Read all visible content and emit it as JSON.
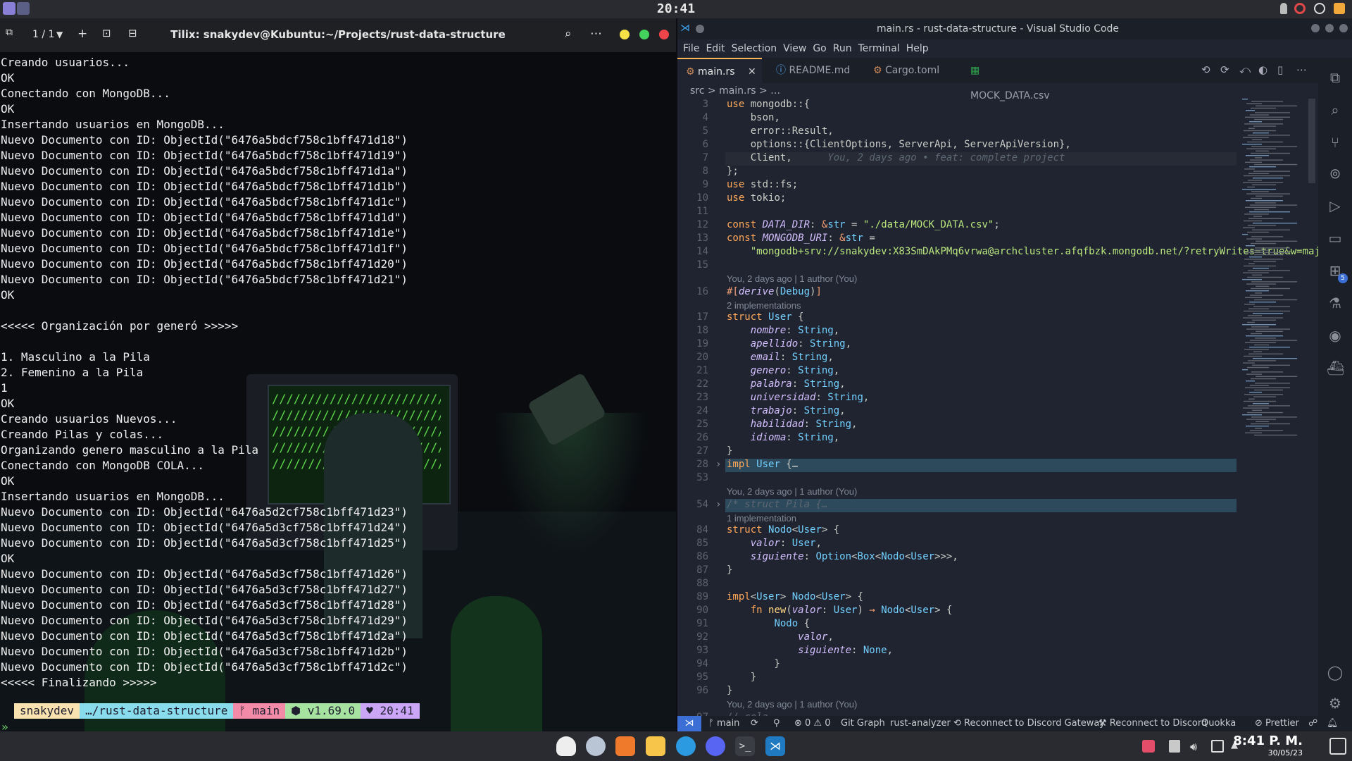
{
  "topbar": {
    "clock": "20:41"
  },
  "terminal": {
    "session": "1 / 1",
    "title": "Tilix: snakydev@Kubuntu:~/Projects/rust-data-structure",
    "lines": [
      "Creando usuarios...",
      "OK",
      "Conectando con MongoDB...",
      "OK",
      "Insertando usuarios en MongoDB...",
      "Nuevo Documento con ID: ObjectId(\"6476a5bdcf758c1bff471d18\")",
      "Nuevo Documento con ID: ObjectId(\"6476a5bdcf758c1bff471d19\")",
      "Nuevo Documento con ID: ObjectId(\"6476a5bdcf758c1bff471d1a\")",
      "Nuevo Documento con ID: ObjectId(\"6476a5bdcf758c1bff471d1b\")",
      "Nuevo Documento con ID: ObjectId(\"6476a5bdcf758c1bff471d1c\")",
      "Nuevo Documento con ID: ObjectId(\"6476a5bdcf758c1bff471d1d\")",
      "Nuevo Documento con ID: ObjectId(\"6476a5bdcf758c1bff471d1e\")",
      "Nuevo Documento con ID: ObjectId(\"6476a5bdcf758c1bff471d1f\")",
      "Nuevo Documento con ID: ObjectId(\"6476a5bdcf758c1bff471d20\")",
      "Nuevo Documento con ID: ObjectId(\"6476a5bdcf758c1bff471d21\")",
      "OK",
      "",
      "<<<<< Organización por generó >>>>>",
      "",
      "1. Masculino a la Pila",
      "2. Femenino a la Pila",
      "1",
      "OK",
      "Creando usuarios Nuevos...",
      "Creando Pilas y colas...",
      "Organizando genero masculino a la Pila",
      "Conectando con MongoDB COLA...",
      "OK",
      "Insertando usuarios en MongoDB...",
      "Nuevo Documento con ID: ObjectId(\"6476a5d2cf758c1bff471d23\")",
      "Nuevo Documento con ID: ObjectId(\"6476a5d3cf758c1bff471d24\")",
      "Nuevo Documento con ID: ObjectId(\"6476a5d3cf758c1bff471d25\")",
      "OK",
      "Nuevo Documento con ID: ObjectId(\"6476a5d3cf758c1bff471d26\")",
      "Nuevo Documento con ID: ObjectId(\"6476a5d3cf758c1bff471d27\")",
      "Nuevo Documento con ID: ObjectId(\"6476a5d3cf758c1bff471d28\")",
      "Nuevo Documento con ID: ObjectId(\"6476a5d3cf758c1bff471d29\")",
      "Nuevo Documento con ID: ObjectId(\"6476a5d3cf758c1bff471d2a\")",
      "Nuevo Documento con ID: ObjectId(\"6476a5d3cf758c1bff471d2b\")",
      "Nuevo Documento con ID: ObjectId(\"6476a5d3cf758c1bff471d2c\")",
      "<<<<< Finalizando >>>>>"
    ],
    "prompt": {
      "user": "snakydev",
      "path": "…/rust-data-structure",
      "branch": "main",
      "node": "v1.69.0",
      "time": "20:41",
      "colors": {
        "user": "#f9e2af",
        "path": "#89dceb",
        "branch": "#f38ba8",
        "node": "#a6e3a1",
        "time": "#cba6f7"
      }
    },
    "prompt_symbol": "»",
    "wallpaper_text": "///////////////////////////"
  },
  "vscode": {
    "title": "main.rs - rust-data-structure - Visual Studio Code",
    "menu": [
      "File",
      "Edit",
      "Selection",
      "View",
      "Go",
      "Run",
      "Terminal",
      "Help"
    ],
    "tabs": [
      "main.rs",
      "README.md",
      "Cargo.toml",
      "MOCK_DATA.csv"
    ],
    "breadcrumb": "src  >  main.rs  > …",
    "blame_inline": "You, 2 days ago • feat: complete project",
    "lens_author": "You, 2 days ago | 1 author (You)",
    "lens_impl2": "2 implementations",
    "lens_impl1": "1 implementation",
    "status": {
      "branch": "main",
      "problems": "⊗ 0 ⚠ 0",
      "git_graph": "Git Graph",
      "rust": "rust-analyzer",
      "discord_gw": "Reconnect to Discord Gateway",
      "discord": "Reconnect to Discord",
      "quokka": "Quokka",
      "prettier": "Prettier"
    },
    "activity_badge": "5",
    "accent": "#ffb454"
  },
  "taskbar": {
    "time": "8:41 P. M.",
    "date": "30/05/23"
  }
}
